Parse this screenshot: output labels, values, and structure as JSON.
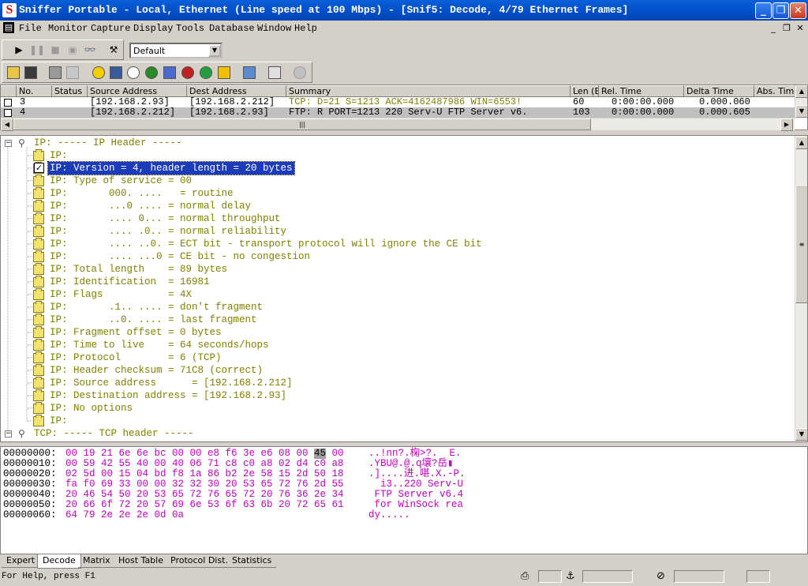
{
  "window": {
    "title": "Sniffer Portable - Local, Ethernet (Line speed at 100 Mbps) - [Snif5: Decode, 4/79 Ethernet Frames]",
    "app_icon_letter": "S",
    "controls": {
      "minimize": "_",
      "restore": "❐",
      "close": "✕"
    }
  },
  "menubar": {
    "items": [
      "File",
      "Monitor",
      "Capture",
      "Display",
      "Tools",
      "Database",
      "Window",
      "Help"
    ],
    "mdi_controls": {
      "minimize": "_",
      "restore": "❐",
      "close": "✕"
    }
  },
  "toolbar": {
    "profile_value": "Default",
    "row1_icons": [
      "play-icon",
      "pause-icon",
      "stop-icon",
      "stop-and-display-icon",
      "binoculars-icon",
      "capture-settings-icon"
    ],
    "row2_icons": [
      "open-icon",
      "save-icon",
      "print-icon",
      "print-preview-icon",
      "dashboard-icon",
      "host-table-icon",
      "matrix-icon",
      "application-response-time-icon",
      "history-samples-icon",
      "protocol-distribution-icon",
      "global-statistics-icon",
      "alarm-log-icon",
      "filter-icon",
      "define-filter-icon",
      "select-filter-icon"
    ]
  },
  "summary": {
    "columns": [
      "No.",
      "Status",
      "Source Address",
      "Dest Address",
      "Summary",
      "Len (B",
      "Rel. Time",
      "Delta Time",
      "Abs. Time"
    ],
    "rows": [
      {
        "no": "3",
        "status": "",
        "src": "[192.168.2.93]",
        "dst": "[192.168.2.212]",
        "summary": "TCP: D=21 S=1213     ACK=4162487986 WIN=6553!",
        "len": "60",
        "rel": "0:00:00.000",
        "delta": "0.000.060",
        "abs": ""
      },
      {
        "no": "4",
        "status": "",
        "src": "[192.168.2.212]",
        "dst": "[192.168.2.93]",
        "summary": "FTP: R PORT=1213   220 Serv-U FTP Server v6.",
        "len": "103",
        "rel": "0:00:00.000",
        "delta": "0.000.605",
        "abs": ""
      }
    ],
    "hscroll_grip": "|||"
  },
  "detail": {
    "ip_header": "IP: ----- IP Header -----",
    "lines": [
      "IP:",
      "IP: Version = 4, header length = 20 bytes",
      "IP: Type of service = 00",
      "IP:       000. ....   = routine",
      "IP:       ...0 .... = normal delay",
      "IP:       .... 0... = normal throughput",
      "IP:       .... .0.. = normal reliability",
      "IP:       .... ..0. = ECT bit - transport protocol will ignore the CE bit",
      "IP:       .... ...0 = CE bit - no congestion",
      "IP: Total length    = 89 bytes",
      "IP: Identification  = 16981",
      "IP: Flags           = 4X",
      "IP:       .1.. .... = don't fragment",
      "IP:       ..0. .... = last fragment",
      "IP: Fragment offset = 0 bytes",
      "IP: Time to live    = 64 seconds/hops",
      "IP: Protocol        = 6 (TCP)",
      "IP: Header checksum = 71C8 (correct)",
      "IP: Source address      = [192.168.2.212]",
      "IP: Destination address = [192.168.2.93]",
      "IP: No options",
      "IP:"
    ],
    "selected_index": 1,
    "tcp_header": "TCP: ----- TCP header -----"
  },
  "hex": {
    "rows": [
      {
        "off": "00000000:",
        "pre": "00 19 21 6e 6e bc 00 00 e8 f6 3e e6 08 00 ",
        "sel": "45",
        "post": " 00",
        "ascii": "..!nn?.椈>?.  E."
      },
      {
        "off": "00000010:",
        "pre": "00 59 42 55 40 00 40 06 71 c8 c0 a8 02 d4 c0 a8",
        "sel": "",
        "post": "",
        "ascii": ".YBU@.@.q壤?岳▮"
      },
      {
        "off": "00000020:",
        "pre": "02 5d 00 15 04 bd f8 1a 86 b2 2e 58 15 2d 50 18",
        "sel": "",
        "post": "",
        "ascii": ".]....进.啿.X.-P."
      },
      {
        "off": "00000030:",
        "pre": "fa f0 69 33 00 00 32 32 30 20 53 65 72 76 2d 55",
        "sel": "",
        "post": "",
        "ascii": "  i3..220 Serv-U"
      },
      {
        "off": "00000040:",
        "pre": "20 46 54 50 20 53 65 72 76 65 72 20 76 36 2e 34",
        "sel": "",
        "post": "",
        "ascii": " FTP Server v6.4"
      },
      {
        "off": "00000050:",
        "pre": "20 66 6f 72 20 57 69 6e 53 6f 63 6b 20 72 65 61",
        "sel": "",
        "post": "",
        "ascii": " for WinSock rea"
      },
      {
        "off": "00000060:",
        "pre": "64 79 2e 2e 2e 0d 0a",
        "sel": "",
        "post": "",
        "ascii": "dy....."
      }
    ]
  },
  "tabs": [
    "Expert",
    "Decode",
    "Matrix",
    "Host Table",
    "Protocol Dist.",
    "Statistics"
  ],
  "active_tab": "Decode",
  "status": {
    "text": "For Help, press F1"
  },
  "colors": {
    "decode_text": "#808000",
    "hex_text": "#c000c0",
    "selection": "#1c3bb8",
    "title_bar": "#0a5fd8"
  }
}
